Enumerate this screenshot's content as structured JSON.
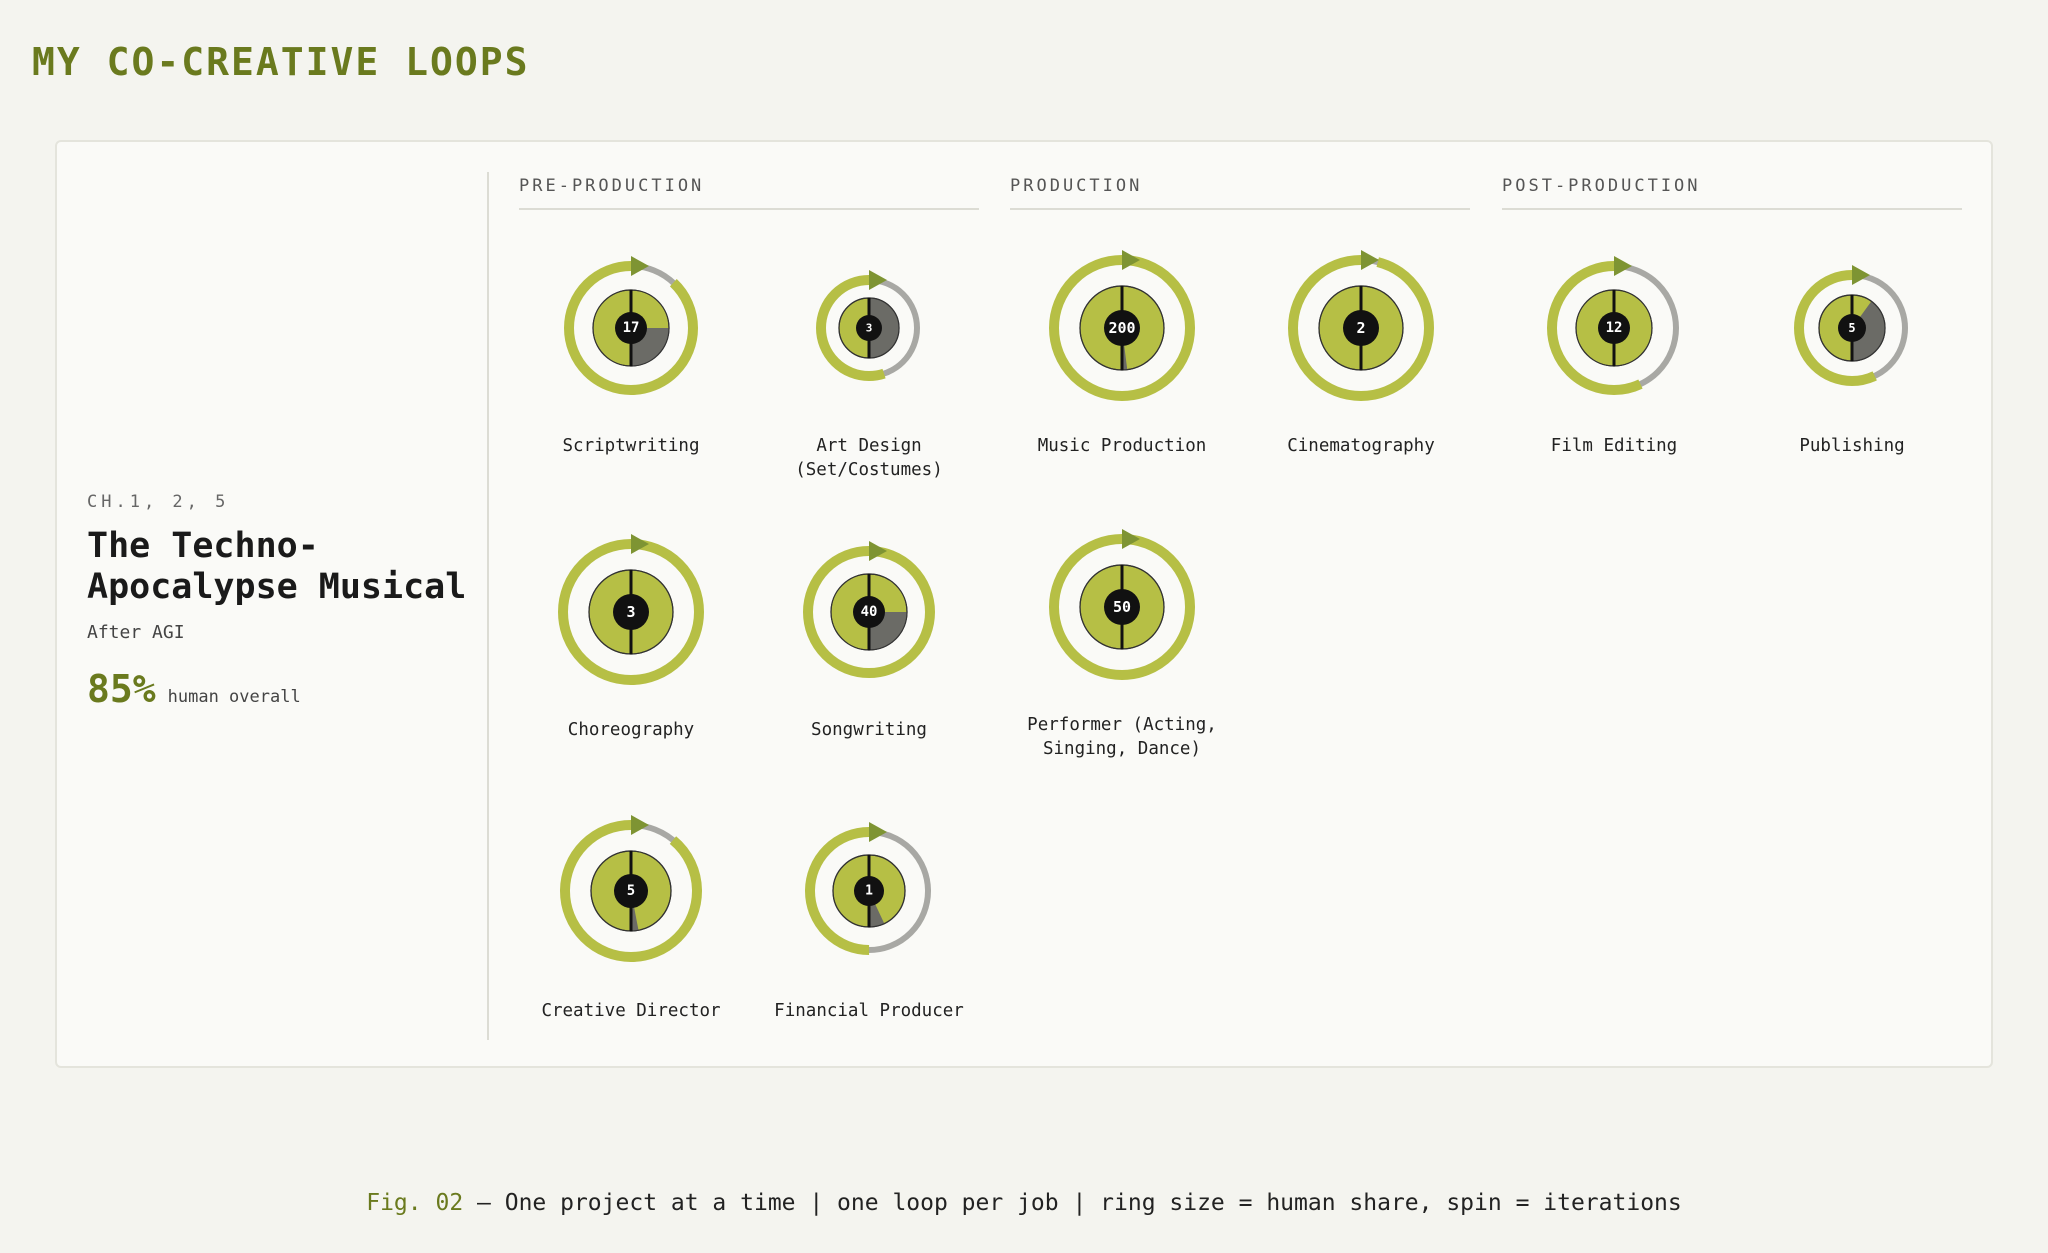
{
  "page": {
    "title": "MY CO-CREATIVE LOOPS"
  },
  "project": {
    "chapters": "CH.1, 2, 5",
    "title": "The Techno-Apocalypse Musical",
    "subtitle": "After AGI",
    "human_overall_value": "85%",
    "human_overall_label": "human overall"
  },
  "phases": [
    "PRE-PRODUCTION",
    "PRODUCTION",
    "POST-PRODUCTION"
  ],
  "colors": {
    "human": "#b6bf45",
    "ai": "#6b6b66",
    "ring_remainder": "#a8a8a4",
    "hub": "#111111",
    "arrow": "#7e9433",
    "accent": "#6a7a1e"
  },
  "loops": [
    {
      "label": "Scriptwriting",
      "iterations": "17",
      "human_share": 0.75
    },
    {
      "label": "Art Design (Set/Costumes)",
      "iterations": "3",
      "human_share": 0.5
    },
    {
      "label": "Music Production",
      "iterations": "200",
      "human_share": 0.98
    },
    {
      "label": "Cinematography",
      "iterations": "2",
      "human_share": 1.0
    },
    {
      "label": "Film Editing",
      "iterations": "12",
      "human_share": 1.0
    },
    {
      "label": "Publishing",
      "iterations": "5",
      "human_share": 0.6
    },
    {
      "label": "Choreography",
      "iterations": "3",
      "human_share": 1.0
    },
    {
      "label": "Songwriting",
      "iterations": "40",
      "human_share": 0.75
    },
    {
      "label": "Performer (Acting, Singing, Dance)",
      "iterations": "50",
      "human_share": 1.0
    },
    {
      "label": "Creative Director",
      "iterations": "5",
      "human_share": 0.97
    },
    {
      "label": "Financial Producer",
      "iterations": "1",
      "human_share": 0.93
    }
  ],
  "caption": {
    "fig": "Fig. 02",
    "text": "— One project at a time | one loop per job | ring size = human share, spin = iterations"
  }
}
